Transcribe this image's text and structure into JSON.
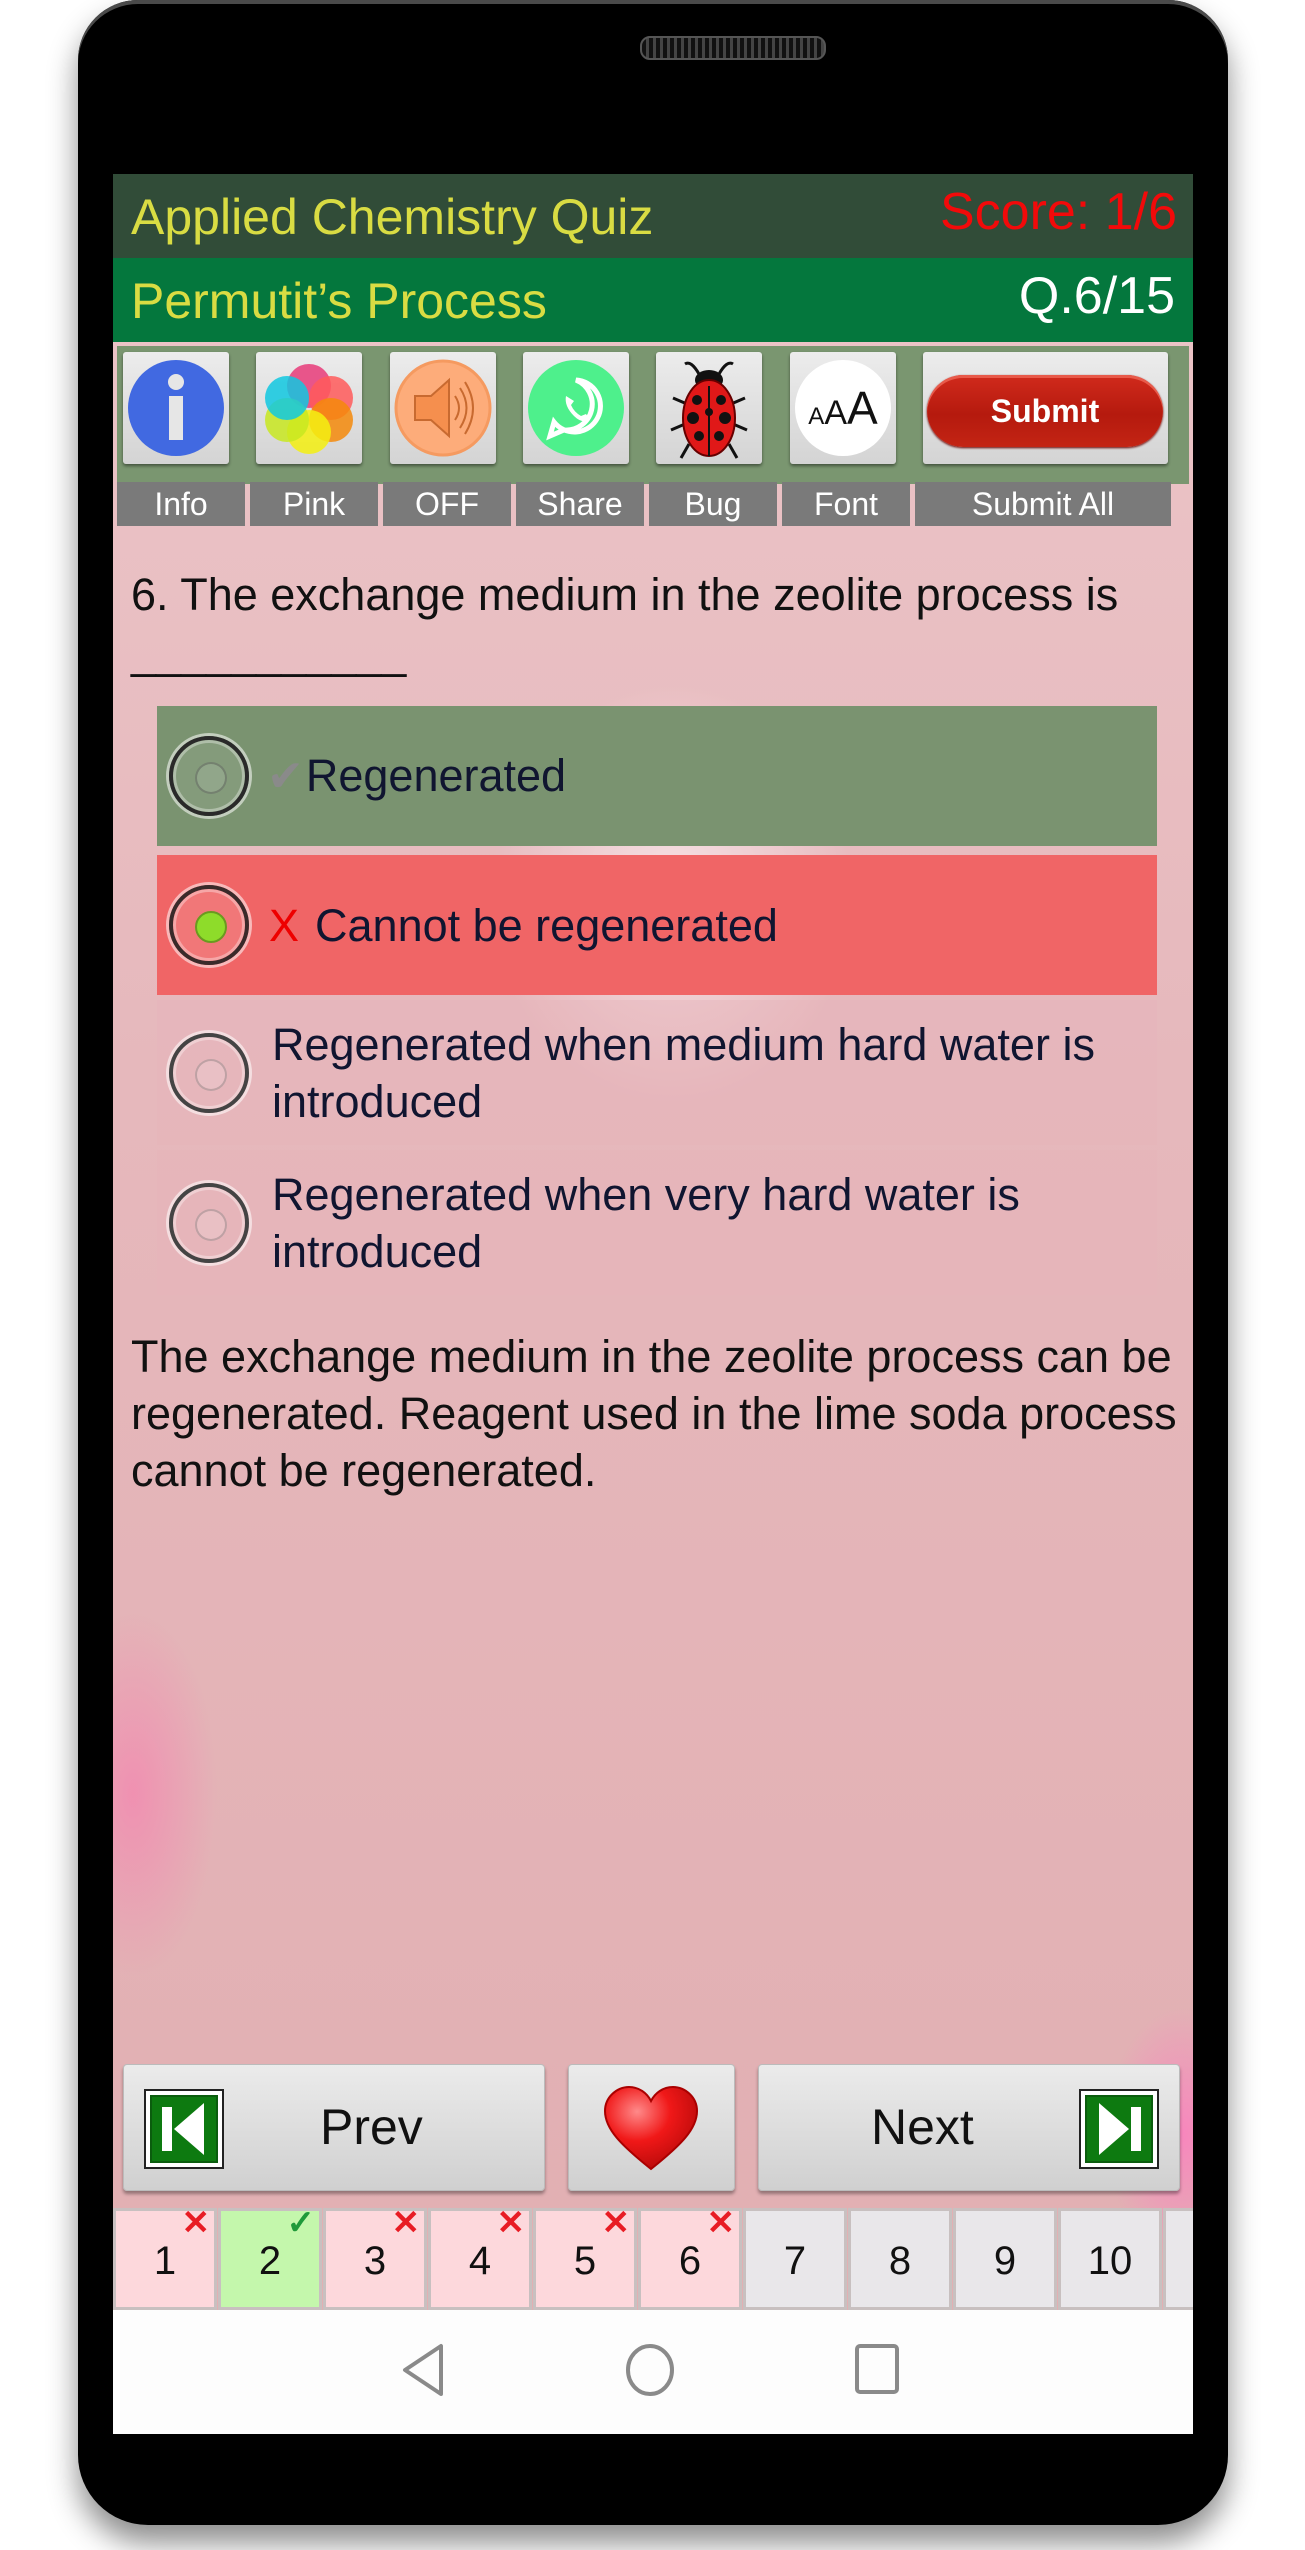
{
  "header": {
    "app_title": "Applied Chemistry Quiz",
    "score": "Score: 1/6",
    "topic": "Permutit’s Process",
    "question_counter": "Q.6/15"
  },
  "toolbar": {
    "buttons": [
      {
        "label": "Info",
        "icon": "info-icon"
      },
      {
        "label": "Pink",
        "icon": "color-theme-icon"
      },
      {
        "label": "OFF",
        "icon": "speaker-icon"
      },
      {
        "label": "Share",
        "icon": "whatsapp-icon"
      },
      {
        "label": "Bug",
        "icon": "ladybug-icon"
      },
      {
        "label": "Font",
        "icon": "font-size-icon"
      },
      {
        "label": "Submit All",
        "icon": "submit-button",
        "button_text": "Submit"
      }
    ],
    "font_icon_text": "AAA"
  },
  "question": {
    "text": "6. The exchange medium in the zeolite process is ___________",
    "options": [
      {
        "text": "Regenerated",
        "mark": "✔",
        "state": "correct",
        "selected": false
      },
      {
        "text": "Cannot be regenerated",
        "mark": "X",
        "state": "wrong",
        "selected": true
      },
      {
        "text": "Regenerated when medium hard water is introduced",
        "mark": "",
        "state": "none",
        "selected": false
      },
      {
        "text": "Regenerated when very hard water is introduced",
        "mark": "",
        "state": "none",
        "selected": false
      }
    ],
    "explanation": "The exchange medium in the zeolite process can be regenerated. Reagent used in the lime soda process cannot be regenerated."
  },
  "navigation": {
    "prev_label": "Prev",
    "next_label": "Next",
    "favorite_icon": "heart-icon"
  },
  "question_strip": [
    {
      "num": "1",
      "status": "wrong",
      "badge": "✕"
    },
    {
      "num": "2",
      "status": "correct",
      "badge": "✓"
    },
    {
      "num": "3",
      "status": "wrong",
      "badge": "✕"
    },
    {
      "num": "4",
      "status": "wrong",
      "badge": "✕"
    },
    {
      "num": "5",
      "status": "wrong",
      "badge": "✕"
    },
    {
      "num": "6",
      "status": "wrong",
      "badge": "✕"
    },
    {
      "num": "7",
      "status": "unanswered",
      "badge": ""
    },
    {
      "num": "8",
      "status": "unanswered",
      "badge": ""
    },
    {
      "num": "9",
      "status": "unanswered",
      "badge": ""
    },
    {
      "num": "10",
      "status": "unanswered",
      "badge": ""
    }
  ],
  "colors": {
    "header_dark": "#314c38",
    "header_green": "#04773d",
    "title_yellow": "#d9dc43",
    "score_red": "#f20a0a",
    "correct_bg": "#7a9370",
    "wrong_bg": "#f06566",
    "strip_wrong": "#fdd8dc",
    "strip_correct": "#c4f7ac",
    "strip_unanswered": "#e9e7ea"
  }
}
